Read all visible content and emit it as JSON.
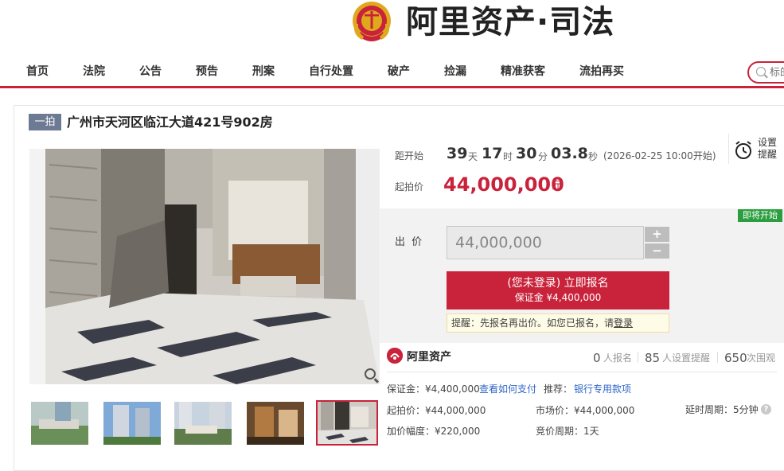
{
  "header": {
    "brand": "阿里资产·司法",
    "emblem_icon": "court-emblem-icon"
  },
  "nav": {
    "items": [
      {
        "label": "首页"
      },
      {
        "label": "法院"
      },
      {
        "label": "公告"
      },
      {
        "label": "预告"
      },
      {
        "label": "刑案"
      },
      {
        "label": "自行处置"
      },
      {
        "label": "破产"
      },
      {
        "label": "捡漏"
      },
      {
        "label": "精准获客"
      },
      {
        "label": "流拍再买"
      }
    ],
    "search_placeholder": "标的"
  },
  "item": {
    "tag": "一拍",
    "title": "广州市天河区临江大道421号902房"
  },
  "auction": {
    "countdown_label": "距开始",
    "days": "39",
    "days_unit": "天",
    "hours": "17",
    "hours_unit": "时",
    "minutes": "30",
    "minutes_unit": "分",
    "seconds": "03.8",
    "seconds_unit": "秒",
    "start_time": "(2026-02-25 10:00开始)",
    "start_price_label": "起拍价",
    "start_price": "44,000,000",
    "price_unit": "元",
    "remind_label": "设置提醒",
    "status_badge": "即将开始",
    "bid_label": "出 价",
    "bid_value": "44,000,000",
    "plus": "+",
    "minus": "−",
    "signup_main": "(您未登录) 立即报名",
    "signup_sub": "保证金 ¥4,400,000",
    "tip_text": "提醒：先报名再出价。如您已报名，请",
    "tip_link": "登录"
  },
  "platform": {
    "name": "阿里资产",
    "signups": "0",
    "signups_label": "人报名",
    "reminders": "85",
    "reminders_label": "人设置提醒",
    "viewers": "650",
    "viewers_label": "次围观"
  },
  "details": {
    "deposit": "保证金：¥4,400,000",
    "how_to_pay": "查看如何支付",
    "recommend_label": "推荐：",
    "bank_link": "银行专用款项",
    "start_price": "起拍价：¥44,000,000",
    "market_price": "市场价：¥44,000,000",
    "delay_period": "延时周期：5分钟",
    "increment": "加价幅度：¥220,000",
    "bid_period": "竞价周期：1天",
    "help": "?"
  },
  "colors": {
    "accent": "#c8233b",
    "badge_green": "#2b9e3f",
    "link_blue": "#2f66c8",
    "tag_gray": "#6d7a94"
  }
}
